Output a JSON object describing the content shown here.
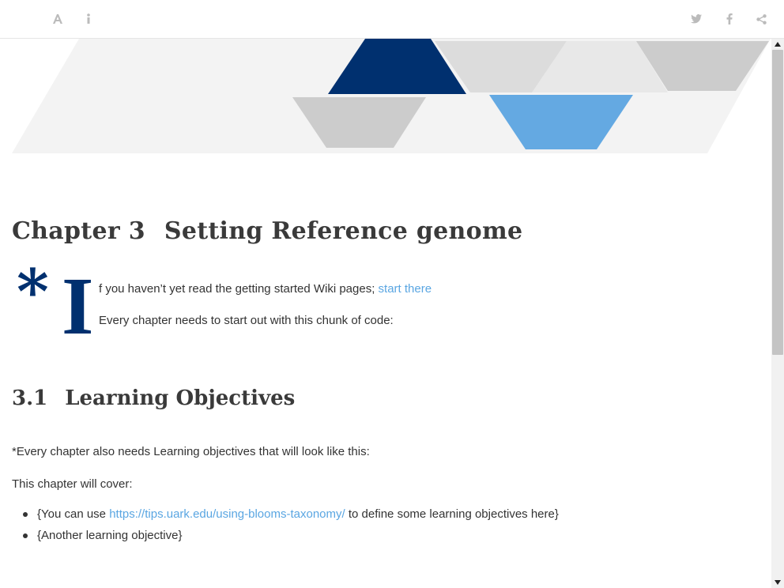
{
  "toolbar": {
    "left_icons": [
      "font-settings-icon",
      "info-icon"
    ],
    "right_icons": [
      "twitter-icon",
      "facebook-icon",
      "share-icon"
    ],
    "icon_color": "#bbbbbb"
  },
  "banner": {
    "colors": {
      "dark_blue": "#00306f",
      "light_blue": "#64a9e2",
      "gray": "#cccccc",
      "light_gray": "#e8e8e8",
      "background": "#f3f3f3"
    }
  },
  "chapter": {
    "number": "Chapter 3",
    "title": "Setting Reference genome"
  },
  "dropcap": {
    "symbol": "*",
    "letter": "I",
    "color": "#00306f"
  },
  "intro": {
    "text_before_link": "f you haven’t yet read the getting started Wiki pages; ",
    "link_text": "start there",
    "chunk_note": "Every chapter needs to start out with this chunk of code:"
  },
  "section": {
    "number": "3.1",
    "title": "Learning Objectives"
  },
  "objectives_note": "*Every chapter also needs Learning objectives that will look like this:",
  "cover_note": "This chapter will cover:",
  "objectives": [
    {
      "before": "{You can use ",
      "link": "https://tips.uark.edu/using-blooms-taxonomy/",
      "after": " to define some learning objectives here}"
    },
    {
      "before": "{Another learning objective}",
      "link": "",
      "after": ""
    }
  ],
  "link_color": "#5aa6e2"
}
